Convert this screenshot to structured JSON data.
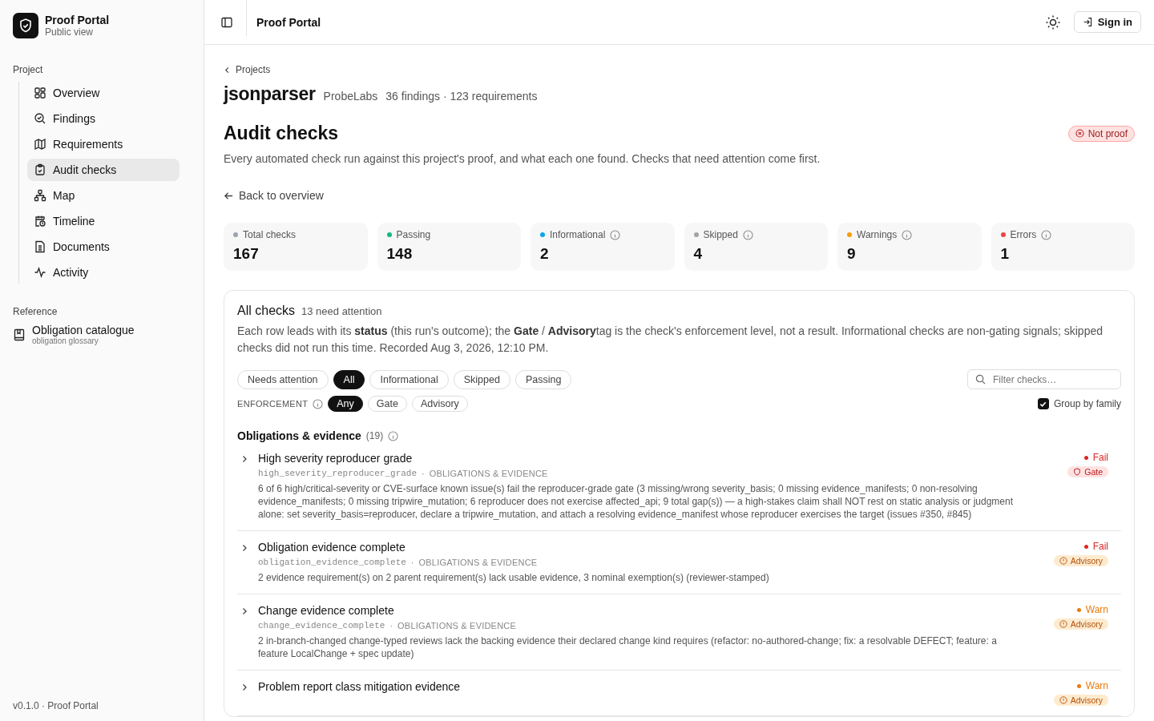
{
  "sidebar": {
    "app_name": "Proof Portal",
    "app_subtitle": "Public view",
    "sections": [
      {
        "label": "Project",
        "items": [
          {
            "label": "Overview",
            "selected": false
          },
          {
            "label": "Findings",
            "selected": false
          },
          {
            "label": "Requirements",
            "selected": false
          },
          {
            "label": "Audit checks",
            "selected": true
          },
          {
            "label": "Map",
            "selected": false
          },
          {
            "label": "Timeline",
            "selected": false
          },
          {
            "label": "Documents",
            "selected": false
          },
          {
            "label": "Activity",
            "selected": false
          }
        ]
      },
      {
        "label": "Reference",
        "items": [
          {
            "label": "Obligation catalogue",
            "subtitle": "obligation glossary",
            "selected": false
          }
        ]
      }
    ],
    "footer": "v0.1.0 · Proof Portal"
  },
  "header": {
    "title": "Proof Portal",
    "sign_in": "Sign in"
  },
  "breadcrumb": "Projects",
  "project": {
    "name": "jsonparser",
    "org": "ProbeLabs",
    "meta": "36 findings · 123 requirements"
  },
  "page": {
    "title": "Audit checks",
    "badge": "Not proof",
    "description": "Every automated check run against this project's proof, and what each one found. Checks that need attention come first.",
    "back_link": "Back to overview"
  },
  "stats": [
    {
      "label": "Total checks",
      "value": "167",
      "color": "#9ca3af",
      "info_icon": false
    },
    {
      "label": "Passing",
      "value": "148",
      "color": "#10b981",
      "info_icon": false
    },
    {
      "label": "Informational",
      "value": "2",
      "color": "#0ea5e9",
      "info_icon": true
    },
    {
      "label": "Skipped",
      "value": "4",
      "color": "#a3a3a3",
      "info_icon": true
    },
    {
      "label": "Warnings",
      "value": "9",
      "color": "#f59e0b",
      "info_icon": true
    },
    {
      "label": "Errors",
      "value": "1",
      "color": "#ef4444",
      "info_icon": true
    }
  ],
  "checks_panel": {
    "title": "All checks",
    "count": "13 need attention",
    "description": "Each row leads with its **status** (this run's outcome); the **Gate** / **Advisory**tag is the check's enforcement level, not a result. Informational checks are non-gating signals; skipped checks did not run this time. Recorded Aug 3, 2026, 12:10 PM.",
    "filters": [
      {
        "label": "Needs attention",
        "selected": false
      },
      {
        "label": "All",
        "selected": true
      },
      {
        "label": "Informational",
        "selected": false
      },
      {
        "label": "Skipped",
        "selected": false
      },
      {
        "label": "Passing",
        "selected": false
      }
    ],
    "search": {
      "placeholder": "Filter checks…"
    },
    "enforcement_label": "ENFORCEMENT",
    "enforcement": [
      {
        "label": "Any",
        "selected": true
      },
      {
        "label": "Gate",
        "selected": false
      },
      {
        "label": "Advisory",
        "selected": false
      }
    ],
    "group_by_family": {
      "label": "Group by family",
      "checked": true
    },
    "group": {
      "title": "Obligations & evidence",
      "count": "(19)",
      "separator": "·",
      "rows": [
        {
          "title": "High severity reproducer grade",
          "code": "high_severity_reproducer_grade",
          "family": "OBLIGATIONS & EVIDENCE",
          "description": "6 of 6 high/critical-severity or CVE-surface known issue(s) fail the reproducer-grade gate (3 missing/wrong severity_basis; 0 missing evidence_manifests; 0 non-resolving evidence_manifests; 0 missing tripwire_mutation; 6 reproducer does not exercise affected_api; 9 total gap(s)) — a high-stakes claim shall NOT rest on static analysis or judgment alone: set severity_basis=reproducer, declare a tripwire_mutation, and attach a resolving evidence_manifest whose reproducer exercises the target (issues #350, #845)",
          "status": {
            "label": "Fail",
            "kind": "fail"
          },
          "enforcement": {
            "label": "Gate",
            "kind": "gate"
          }
        },
        {
          "title": "Obligation evidence complete",
          "code": "obligation_evidence_complete",
          "family": "OBLIGATIONS & EVIDENCE",
          "description": "2 evidence requirement(s) on 2 parent requirement(s) lack usable evidence, 3 nominal exemption(s) (reviewer-stamped)",
          "status": {
            "label": "Fail",
            "kind": "fail"
          },
          "enforcement": {
            "label": "Advisory",
            "kind": "advisory"
          }
        },
        {
          "title": "Change evidence complete",
          "code": "change_evidence_complete",
          "family": "OBLIGATIONS & EVIDENCE",
          "description": "2 in-branch-changed change-typed reviews lack the backing evidence their declared change kind requires (refactor: no-authored-change; fix: a resolvable DEFECT; feature: a feature LocalChange + spec update)",
          "status": {
            "label": "Warn",
            "kind": "warn"
          },
          "enforcement": {
            "label": "Advisory",
            "kind": "advisory"
          }
        },
        {
          "title": "Problem report class mitigation evidence",
          "status": {
            "label": "Warn",
            "kind": "warn"
          },
          "enforcement": {
            "label": "Advisory",
            "kind": "advisory"
          }
        }
      ]
    }
  }
}
